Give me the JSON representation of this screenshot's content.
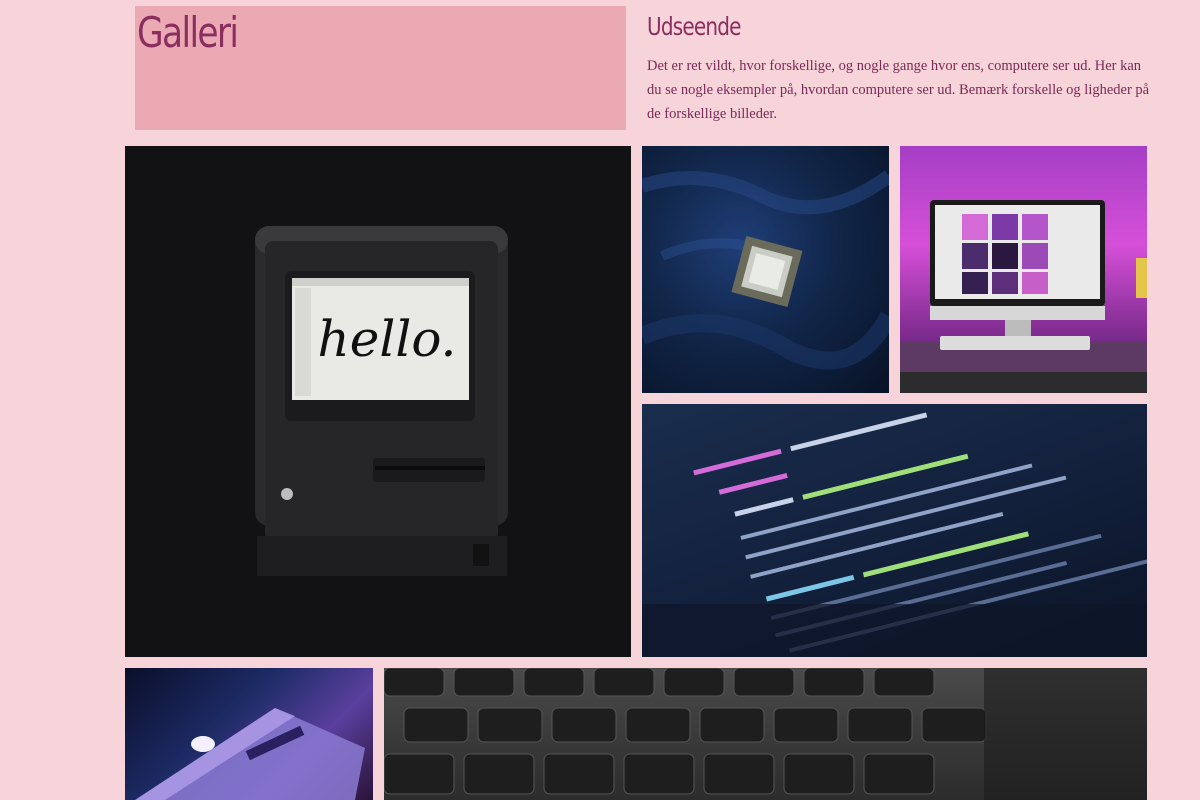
{
  "header": {
    "title": "Galleri"
  },
  "intro": {
    "heading": "Udseende",
    "text": "Det er ret vildt, hvor forskellige, og nogle gange hvor ens, computere ser ud. Her kan du se nogle eksempler på, hvordan computere ser ud. Bemærk forskelle og ligheder på de forskellige billeder."
  },
  "gallery": {
    "mac_screen_text": "hello."
  },
  "colors": {
    "background": "#f7d3da",
    "title_box": "#eaa9b3",
    "accent": "#8a2e5f"
  }
}
